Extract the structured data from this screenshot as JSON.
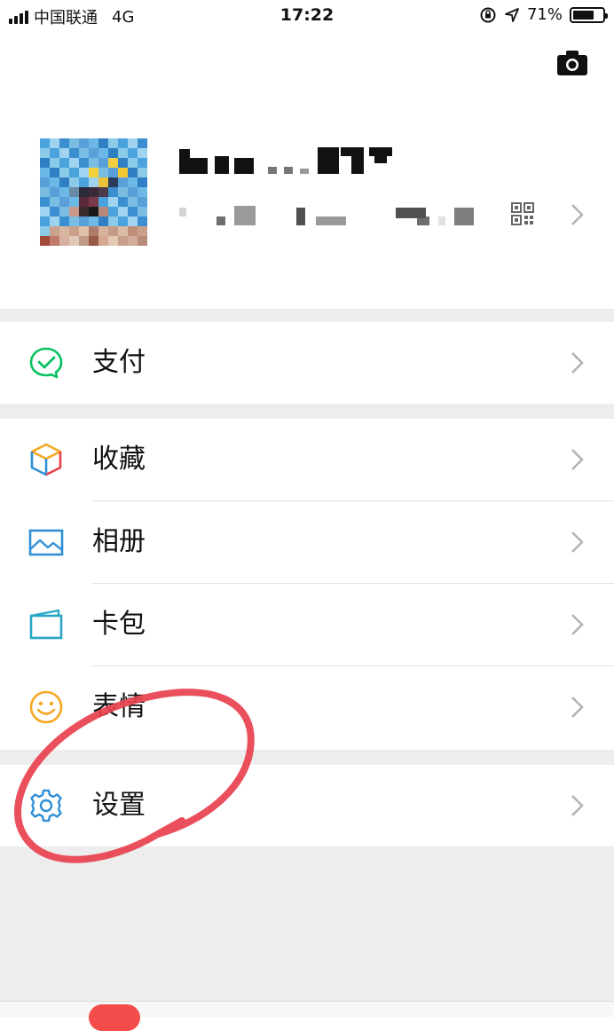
{
  "status_bar": {
    "carrier": "中国联通",
    "network": "4G",
    "time": "17:22",
    "battery_percent": "71%",
    "battery_level": 0.71
  },
  "header": {
    "camera_icon": "camera-icon"
  },
  "profile": {
    "avatar_icon": "avatar",
    "qr_icon": "qr-code-icon",
    "chevron_icon": "chevron-right-icon"
  },
  "menu": {
    "pay": {
      "label": "支付",
      "icon": "wechat-pay-icon",
      "color": "#07c160"
    },
    "favorites": {
      "label": "收藏",
      "icon": "cube-icon"
    },
    "album": {
      "label": "相册",
      "icon": "photo-icon",
      "color": "#2f8fd6"
    },
    "cards": {
      "label": "卡包",
      "icon": "card-wallet-icon",
      "color": "#2aa6c6"
    },
    "stickers": {
      "label": "表情",
      "icon": "smiley-icon",
      "color": "#f5a623"
    },
    "settings": {
      "label": "设置",
      "icon": "gear-icon",
      "color": "#2f8fd6"
    }
  },
  "colors": {
    "background": "#ffffff",
    "section_gap": "#ededed",
    "annotation_red": "#e8414e"
  }
}
